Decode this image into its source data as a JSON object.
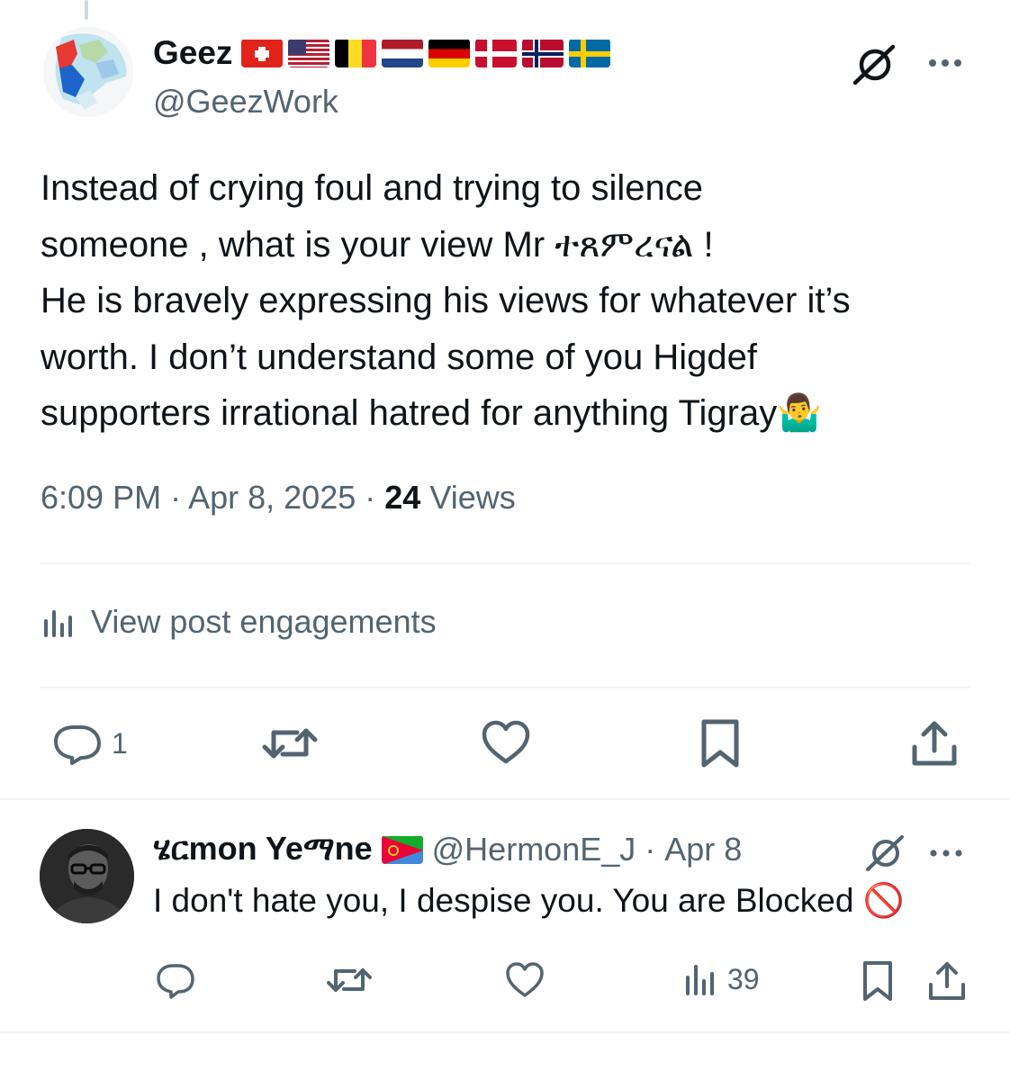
{
  "post": {
    "author_name": "Geez",
    "author_handle": "@GeezWork",
    "flag_icons": [
      "switzerland-flag",
      "usa-flag",
      "belgium-flag",
      "netherlands-flag",
      "germany-flag",
      "denmark-flag",
      "norway-flag",
      "sweden-flag"
    ],
    "text_lines": [
      "Instead of crying foul and trying to silence",
      "someone , what is your view  Mr ተጸምረናል !",
      "He is bravely expressing his views for whatever it’s",
      "worth. I don’t understand some of you Higdef",
      "supporters irrational hatred for anything Tigray"
    ],
    "emoji": "🤷‍♂️",
    "time": "6:09 PM",
    "date": "Apr 8, 2025",
    "separator": "·",
    "views_count": "24",
    "views_label": "Views",
    "engagements_label": "View post engagements",
    "reply_count": "1"
  },
  "reply": {
    "author_name": "ሄርmon Yeማne",
    "flag_icon": "eritrea-flag",
    "handle": "@HermonE_J",
    "separator": "·",
    "date": "Apr 8",
    "text": "I don't hate you, I despise you. You are Blocked",
    "blocked_emoji": "🚫",
    "views_count": "39"
  },
  "colors": {
    "text_primary": "#0f1419",
    "text_secondary": "#536471",
    "divider": "#eff3f4",
    "blocked_red": "#e0245e"
  }
}
